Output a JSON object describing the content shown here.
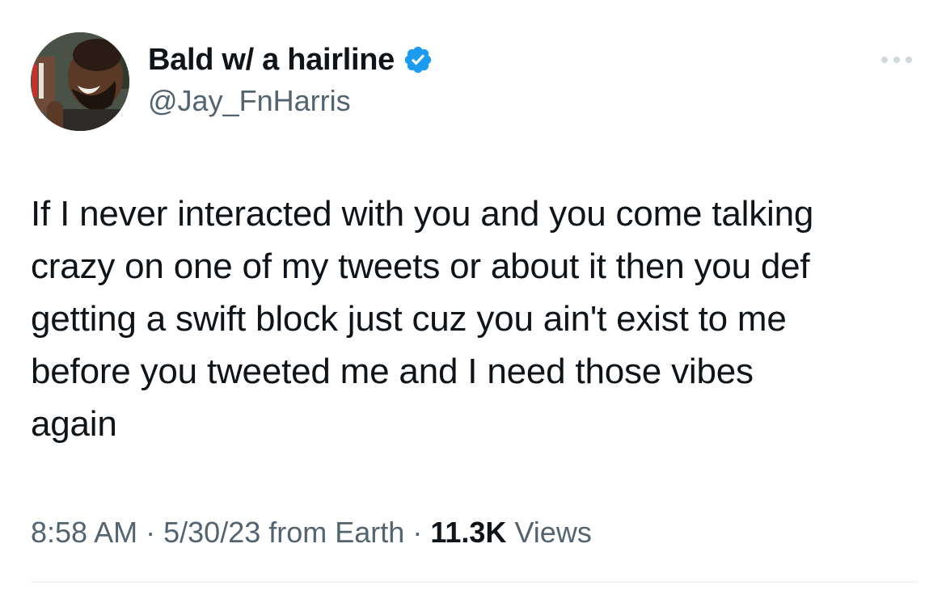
{
  "author": {
    "display_name": "Bald w/ a hairline",
    "handle": "@Jay_FnHarris",
    "verified": true,
    "verified_badge_color": "#1d9bf0"
  },
  "more_menu": {
    "icon": "more-horizontal-icon"
  },
  "tweet": {
    "text": "If I never interacted with you and you come talking\ncrazy on one of my tweets or about it then you def\ngetting a swift block just cuz you ain't exist to me\nbefore you tweeted me and I need those vibes\nagain"
  },
  "meta": {
    "time": "8:58 AM",
    "date": "5/30/23",
    "source": "from Earth",
    "views_count": "11.3K",
    "views_label": "Views",
    "separator": "·"
  },
  "colors": {
    "text_primary": "#0f1419",
    "text_secondary": "#536471",
    "divider": "#eff3f4"
  }
}
